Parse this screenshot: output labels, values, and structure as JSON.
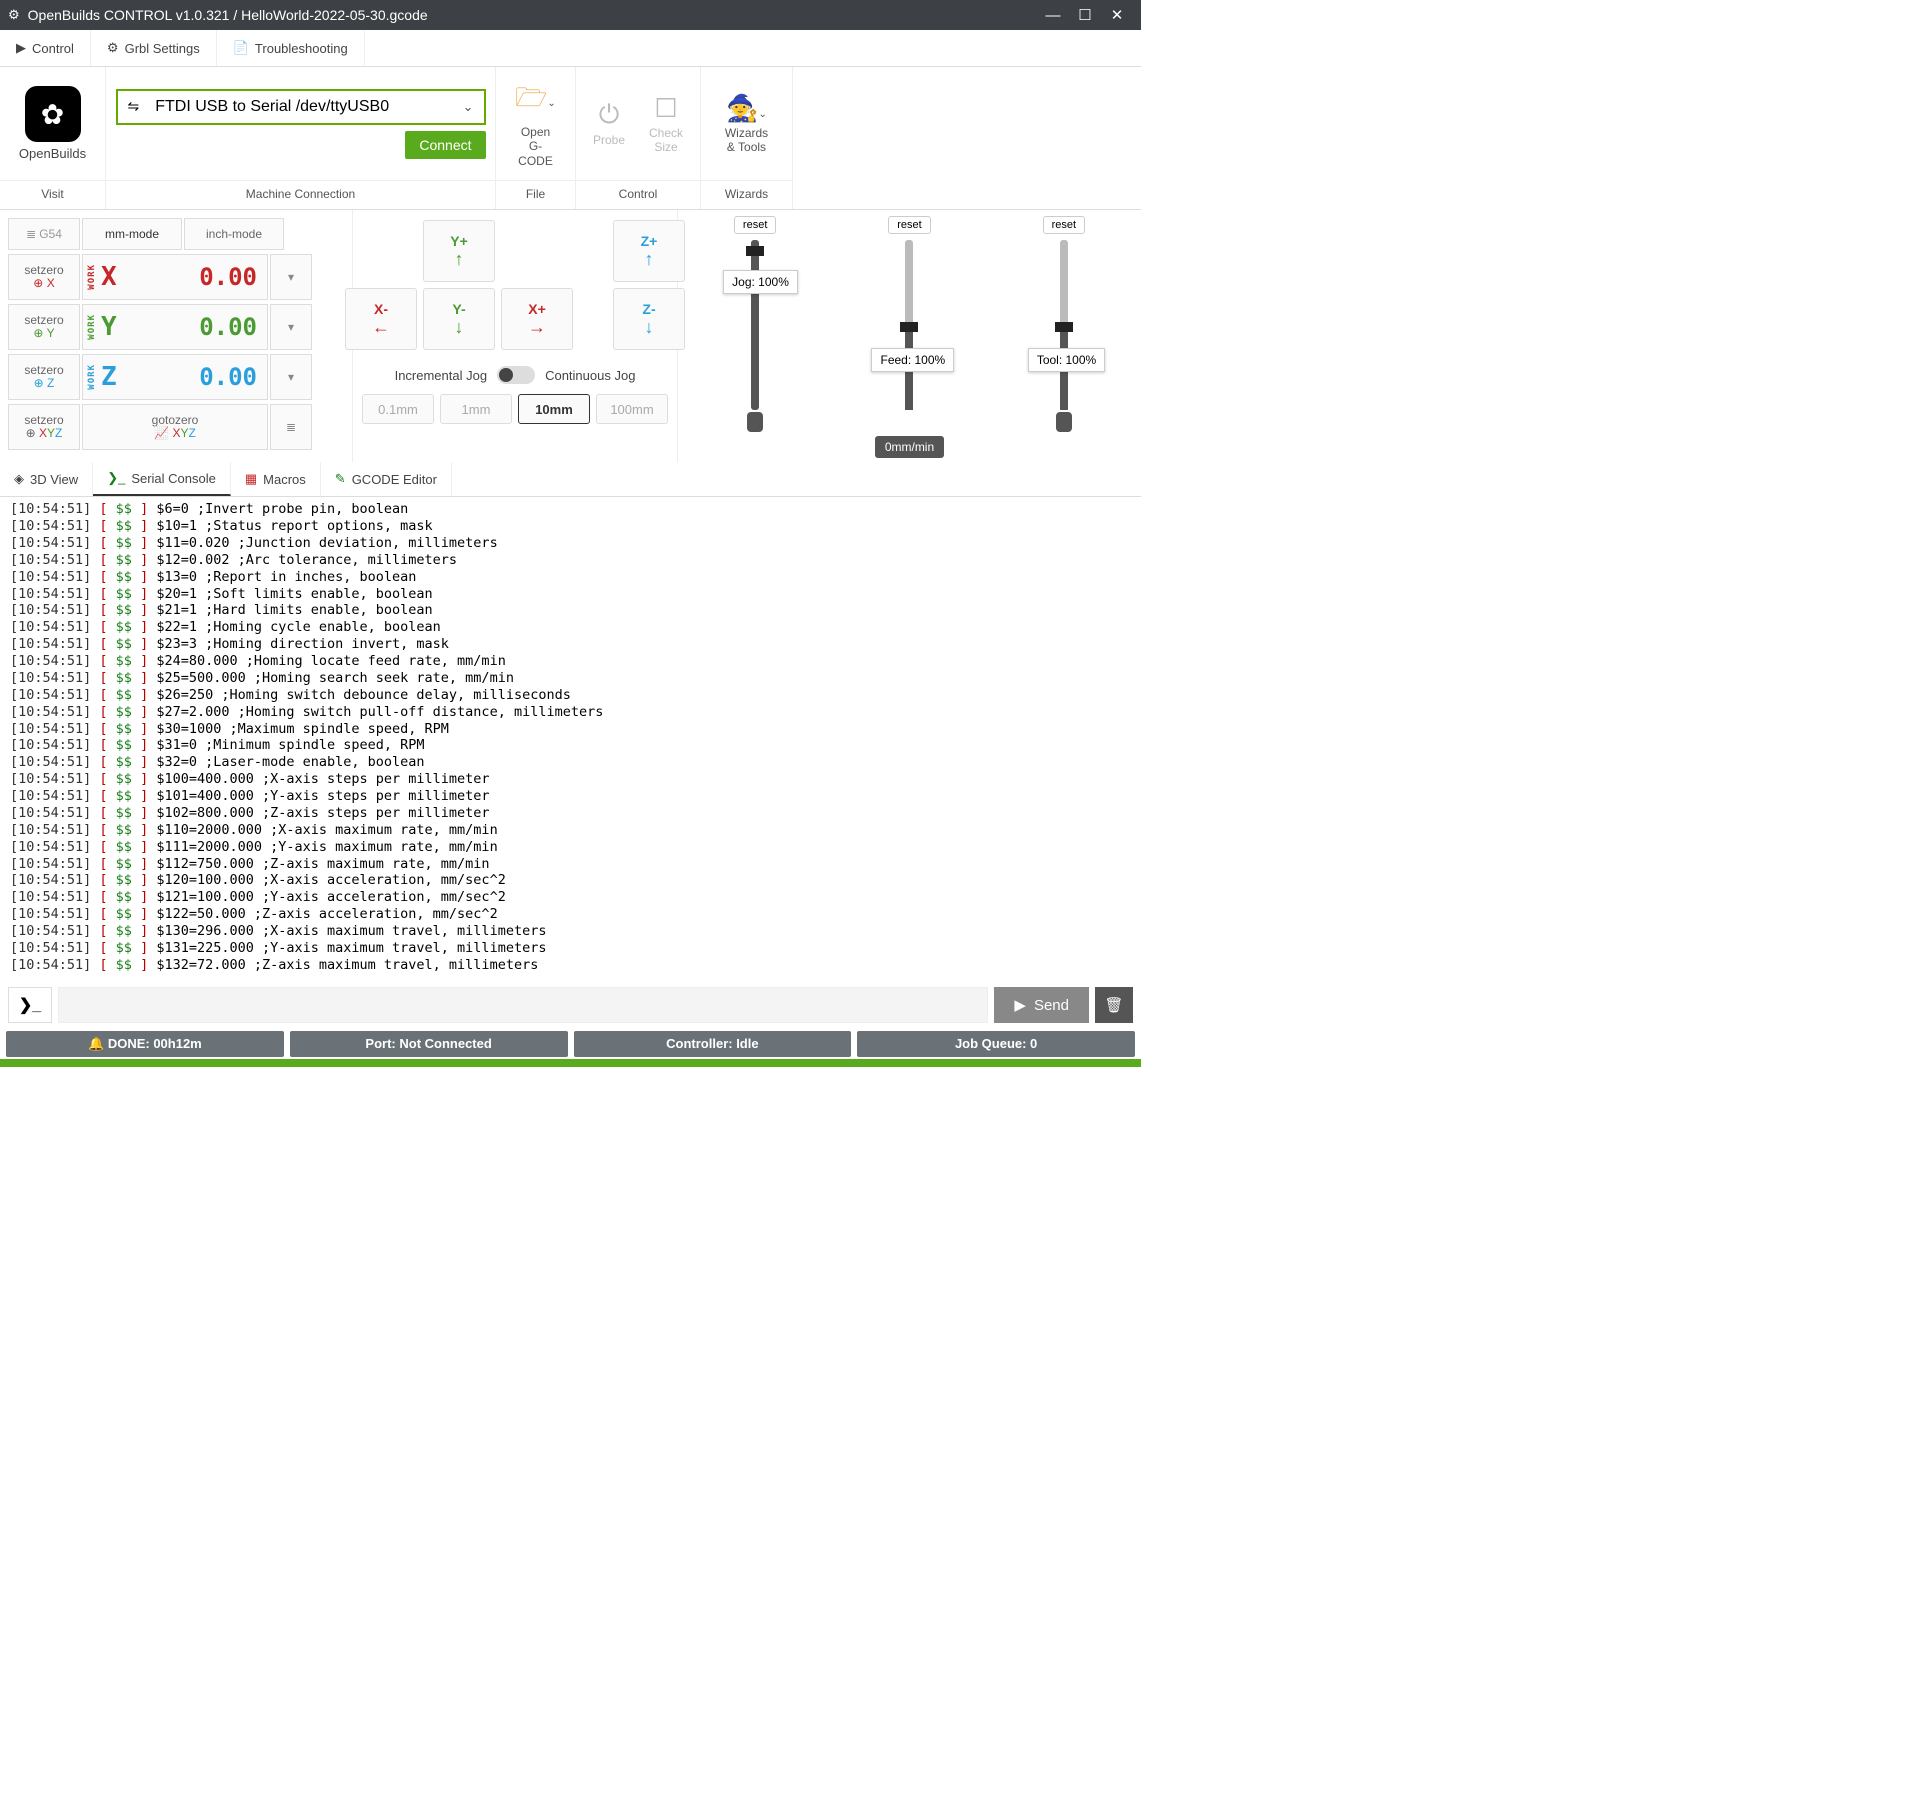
{
  "titlebar": {
    "title": "OpenBuilds CONTROL v1.0.321 / HelloWorld-2022-05-30.gcode"
  },
  "tabs": {
    "control": "Control",
    "grbl": "Grbl Settings",
    "trouble": "Troubleshooting"
  },
  "toolbar": {
    "visit": {
      "brand": "OpenBuilds",
      "label": "Visit"
    },
    "machine": {
      "port": "FTDI USB to Serial /dev/ttyUSB0",
      "connect": "Connect",
      "label": "Machine Connection"
    },
    "file": {
      "open1": "Open",
      "open2": "G-CODE",
      "label": "File"
    },
    "control": {
      "probe": "Probe",
      "check1": "Check",
      "check2": "Size",
      "label": "Control"
    },
    "wizards": {
      "wiz1": "Wizards",
      "wiz2": "& Tools",
      "label": "Wizards"
    }
  },
  "dro": {
    "g54": "G54",
    "mm": "mm-mode",
    "inch": "inch-mode",
    "setzero": "setzero",
    "gotozero": "gotozero",
    "xyz": "XYZ",
    "x": {
      "axis": "X",
      "val": "0.00"
    },
    "y": {
      "axis": "Y",
      "val": "0.00"
    },
    "z": {
      "axis": "Z",
      "val": "0.00"
    },
    "work": "WORK"
  },
  "jog": {
    "yplus": "Y+",
    "yminus": "Y-",
    "xplus": "X+",
    "xminus": "X-",
    "zplus": "Z+",
    "zminus": "Z-",
    "inc": "Incremental Jog",
    "cont": "Continuous Jog",
    "i01": "0.1mm",
    "i1": "1mm",
    "i10": "10mm",
    "i100": "100mm"
  },
  "sliders": {
    "reset": "reset",
    "jog": "Jog: 100%",
    "feed": "Feed: 100%",
    "feedbadge": "0mm/min",
    "tool": "Tool: 100%"
  },
  "subtabs": {
    "view3d": "3D View",
    "serial": "Serial Console",
    "macros": "Macros",
    "gcode": "GCODE Editor"
  },
  "console": {
    "ts": "[10:54:51]",
    "tagopen": " [ ",
    "tag": "$$",
    "tagclose": " ] ",
    "lines": [
      "$6=0 ;Invert probe pin, boolean",
      "$10=1 ;Status report options, mask",
      "$11=0.020 ;Junction deviation, millimeters",
      "$12=0.002 ;Arc tolerance, millimeters",
      "$13=0 ;Report in inches, boolean",
      "$20=1 ;Soft limits enable, boolean",
      "$21=1 ;Hard limits enable, boolean",
      "$22=1 ;Homing cycle enable, boolean",
      "$23=3 ;Homing direction invert, mask",
      "$24=80.000 ;Homing locate feed rate, mm/min",
      "$25=500.000 ;Homing search seek rate, mm/min",
      "$26=250 ;Homing switch debounce delay, milliseconds",
      "$27=2.000 ;Homing switch pull-off distance, millimeters",
      "$30=1000 ;Maximum spindle speed, RPM",
      "$31=0 ;Minimum spindle speed, RPM",
      "$32=0 ;Laser-mode enable, boolean",
      "$100=400.000 ;X-axis steps per millimeter",
      "$101=400.000 ;Y-axis steps per millimeter",
      "$102=800.000 ;Z-axis steps per millimeter",
      "$110=2000.000 ;X-axis maximum rate, mm/min",
      "$111=2000.000 ;Y-axis maximum rate, mm/min",
      "$112=750.000 ;Z-axis maximum rate, mm/min",
      "$120=100.000 ;X-axis acceleration, mm/sec^2",
      "$121=100.000 ;Y-axis acceleration, mm/sec^2",
      "$122=50.000 ;Z-axis acceleration, mm/sec^2",
      "$130=296.000 ;X-axis maximum travel, millimeters",
      "$131=225.000 ;Y-axis maximum travel, millimeters",
      "$132=72.000 ;Z-axis maximum travel, millimeters"
    ]
  },
  "cmd": {
    "send": "Send"
  },
  "status": {
    "done": "DONE: 00h12m",
    "port": "Port: Not Connected",
    "controller": "Controller: Idle",
    "queue": "Job Queue: 0"
  }
}
